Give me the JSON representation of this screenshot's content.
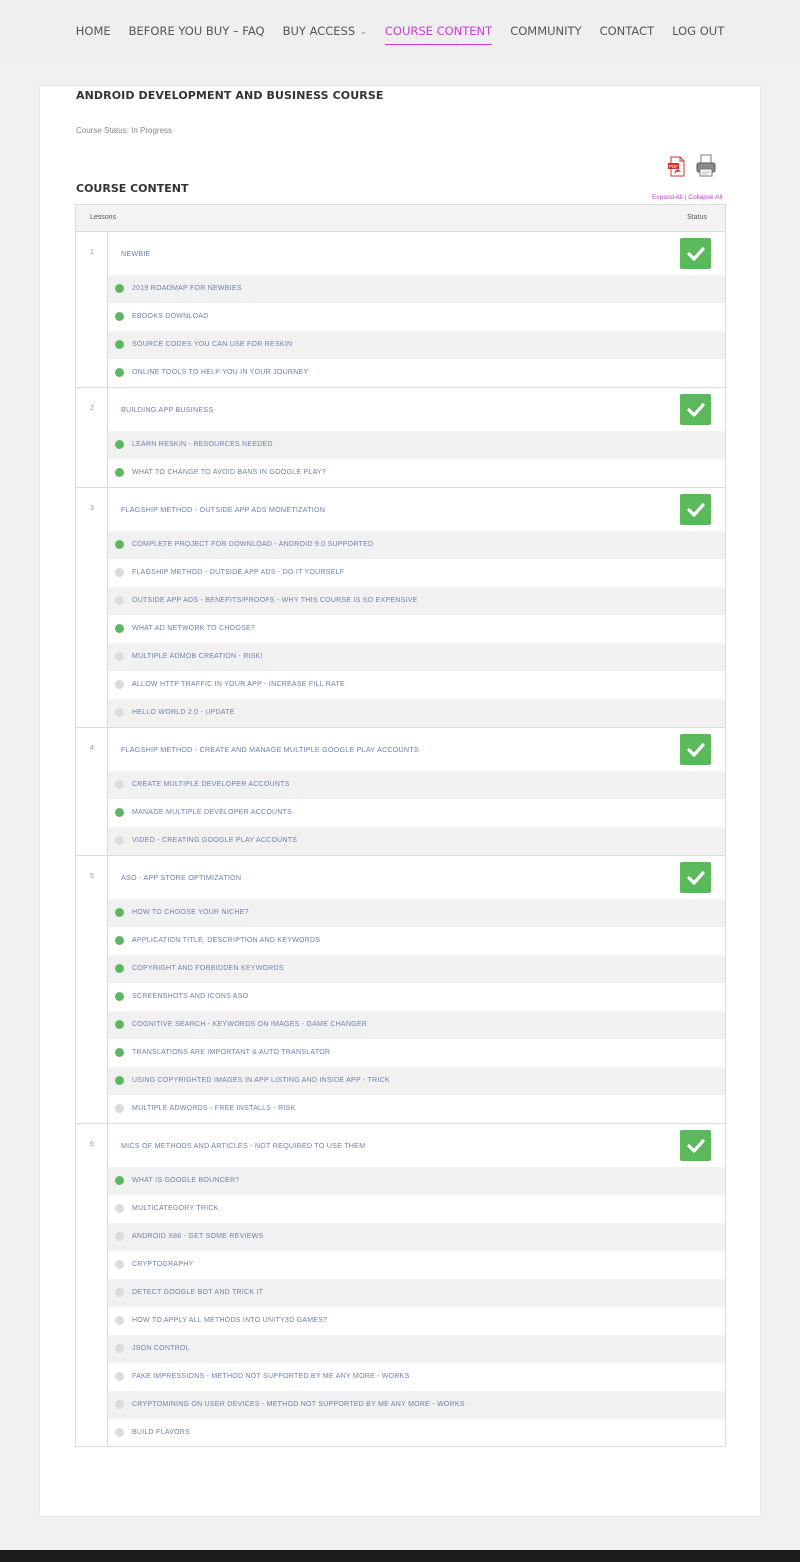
{
  "nav": {
    "items": [
      {
        "label": "HOME",
        "active": false
      },
      {
        "label": "BEFORE YOU BUY – FAQ",
        "active": false
      },
      {
        "label": "BUY ACCESS",
        "active": false,
        "dropdown": true
      },
      {
        "label": "COURSE CONTENT",
        "active": true
      },
      {
        "label": "COMMUNITY",
        "active": false
      },
      {
        "label": "CONTACT",
        "active": false
      },
      {
        "label": "LOG OUT",
        "active": false
      }
    ]
  },
  "course": {
    "title": "ANDROID DEVELOPMENT AND BUSINESS COURSE",
    "status": "Course Status: In Progress",
    "content_heading": "COURSE CONTENT",
    "expand_all": "Expand All",
    "collapse_all": "Collapse All",
    "separator": "|",
    "icons": {
      "pdf": "pdf-icon",
      "print": "printer-icon"
    }
  },
  "table": {
    "col_lessons": "Lessons",
    "col_status": "Status",
    "groups": [
      {
        "num": "1",
        "title": "NEWBIE",
        "complete": true,
        "lessons": [
          {
            "title": "2019 ROADMAP FOR NEWBIES",
            "done": true
          },
          {
            "title": "EBOOKS DOWNLOAD",
            "done": true
          },
          {
            "title": "SOURCE CODES YOU CAN USE FOR RESKIN",
            "done": true
          },
          {
            "title": "ONLINE TOOLS TO HELP YOU IN YOUR JOURNEY",
            "done": true
          }
        ]
      },
      {
        "num": "2",
        "title": "BUILDING APP BUSINESS",
        "complete": true,
        "lessons": [
          {
            "title": "LEARN RESKIN - RESOURCES NEEDED",
            "done": true
          },
          {
            "title": "WHAT TO CHANGE TO AVOID BANS IN GOOGLE PLAY?",
            "done": true
          }
        ]
      },
      {
        "num": "3",
        "title": "FLAGSHIP METHOD - OUTSIDE APP ADS MONETIZATION",
        "complete": true,
        "lessons": [
          {
            "title": "COMPLETE PROJECT FOR DOWNLOAD - ANDROID 9.0 SUPPORTED",
            "done": true
          },
          {
            "title": "FLAGSHIP METHOD - OUTSIDE APP ADS - DO IT YOURSELF",
            "done": false
          },
          {
            "title": "OUTSIDE APP ADS - BENEFITS/PROOFS - WHY THIS COURSE IS SO EXPENSIVE",
            "done": false
          },
          {
            "title": "WHAT AD NETWORK TO CHOOSE?",
            "done": true
          },
          {
            "title": "MULTIPLE ADMOB CREATION - RISK!",
            "done": false
          },
          {
            "title": "ALLOW HTTP TRAFFIC IN YOUR APP - INCREASE FILL RATE",
            "done": false
          },
          {
            "title": "HELLO WORLD 2.0 - UPDATE",
            "done": false
          }
        ]
      },
      {
        "num": "4",
        "title": "FLAGSHIP METHOD - CREATE AND MANAGE MULTIPLE GOOGLE PLAY ACCOUNTS",
        "complete": true,
        "lessons": [
          {
            "title": "CREATE MULTIPLE DEVELOPER ACCOUNTS",
            "done": false
          },
          {
            "title": "MANAGE MULTIPLE DEVELOPER ACCOUNTS",
            "done": true
          },
          {
            "title": "VIDEO - CREATING GOOGLE PLAY ACCOUNTS",
            "done": false
          }
        ]
      },
      {
        "num": "5",
        "title": "ASO - APP STORE OPTIMIZATION",
        "complete": true,
        "lessons": [
          {
            "title": "HOW TO CHOOSE YOUR NICHE?",
            "done": true
          },
          {
            "title": "APPLICATION TITLE, DESCRIPTION AND KEYWORDS",
            "done": true
          },
          {
            "title": "COPYRIGHT AND FORBIDDEN KEYWORDS",
            "done": true
          },
          {
            "title": "SCREENSHOTS AND ICONS ASO",
            "done": true
          },
          {
            "title": "COGNITIVE SEARCH - KEYWORDS ON IMAGES - GAME CHANGER",
            "done": true
          },
          {
            "title": "TRANSLATIONS ARE IMPORTANT & AUTO TRANSLATOR",
            "done": true
          },
          {
            "title": "USING COPYRIGHTED IMAGES IN APP LISTING AND INSIDE APP - TRICK",
            "done": true
          },
          {
            "title": "MULTIPLE ADWORDS - FREE INSTALLS - RISK",
            "done": false
          }
        ]
      },
      {
        "num": "6",
        "title": "MICS OF METHODS AND ARTICLES - NOT REQUIRED TO USE THEM",
        "complete": true,
        "lessons": [
          {
            "title": "WHAT IS GOOGLE BOUNCER?",
            "done": true
          },
          {
            "title": "MULTICATEGORY TRICK",
            "done": false
          },
          {
            "title": "ANDROID X86 - GET SOME REVIEWS",
            "done": false
          },
          {
            "title": "CRYPTOGRAPHY",
            "done": false
          },
          {
            "title": "DETECT GOOGLE BOT AND TRICK IT",
            "done": false
          },
          {
            "title": "HOW TO APPLY ALL METHODS INTO UNITY3D GAMES?",
            "done": false
          },
          {
            "title": "JSON CONTROL",
            "done": false
          },
          {
            "title": "FAKE IMPRESSIONS - METHOD NOT SUPPORTED BY ME ANY MORE - WORKS",
            "done": false
          },
          {
            "title": "CRYPTOMINING ON USER DEVICES - METHOD NOT SUPPORTED BY ME ANY MORE - WORKS",
            "done": false
          },
          {
            "title": "BUILD FLAVORS",
            "done": false
          }
        ]
      }
    ]
  },
  "colors": {
    "accent": "#d13ad8",
    "done": "#5cb85c",
    "pending": "#dcdcdc",
    "lesson_text": "#7081a6"
  }
}
